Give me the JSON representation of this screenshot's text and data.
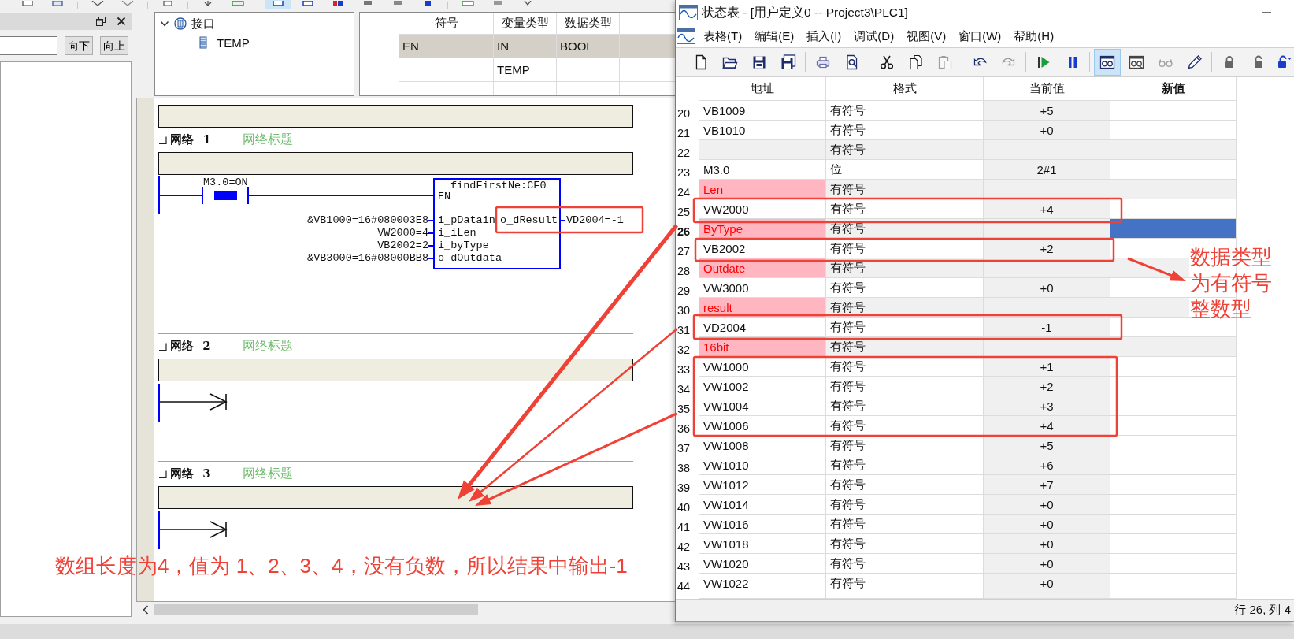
{
  "main_window": {
    "toolbar": [
      [
        {
          "pressed": false
        },
        {
          "pressed": false
        }
      ],
      [
        {
          "pressed": false
        },
        {
          "pressed": false
        }
      ],
      [
        {
          "pressed": false
        }
      ],
      [
        {
          "pressed": false
        },
        {
          "pressed": false
        }
      ],
      [
        {
          "pressed": true
        },
        {
          "pressed": false
        },
        {
          "pressed": false
        },
        {
          "pressed": false
        },
        {
          "pressed": false
        },
        {
          "pressed": false
        }
      ],
      [
        {
          "pressed": false
        },
        {
          "pressed": false
        },
        {
          "pressed": false
        }
      ]
    ],
    "search_buttons": [
      "向下",
      "向上"
    ],
    "interface_tree": [
      {
        "label": "接口",
        "expanded": true,
        "children": [
          {
            "label": "TEMP"
          }
        ]
      }
    ],
    "variable_table": {
      "columns": [
        "符号",
        "变量类型",
        "数据类型"
      ],
      "rows": [
        {
          "symbol": "EN",
          "var_type": "IN",
          "data_type": "BOOL",
          "selected": true
        },
        {
          "var_type": "TEMP",
          "selected": false
        }
      ]
    },
    "networks": [
      {
        "label": "网络 1",
        "title": "网络标题",
        "expanded": true,
        "ladder": {
          "kind": "function_block",
          "contact": {
            "label": "M3.0=ON",
            "energized": true
          },
          "block": {
            "title": "findFirstNe:CF0",
            "enable": "EN",
            "left_pins": [
              {
                "name": "i_pDatain",
                "operand": "&VB1000=16#080003E8"
              },
              {
                "name": "i_iLen",
                "operand": "VW2000=4"
              },
              {
                "name": "i_byType",
                "operand": "VB2002=2"
              },
              {
                "name": "o_dOutdata",
                "operand": "&VB3000=16#08000BB8"
              }
            ],
            "right_pins": [
              {
                "name": "o_dResult",
                "operand": "VD2004=-1"
              }
            ]
          }
        }
      },
      {
        "label": "网络 2",
        "title": "网络标题",
        "expanded": true,
        "ladder": {
          "kind": "empty"
        }
      },
      {
        "label": "网络 3",
        "title": "网络标题",
        "expanded": true,
        "ladder": {
          "kind": "empty"
        }
      }
    ]
  },
  "status_window": {
    "title": "状态表 - [用户定义0 -- Project3\\PLC1]",
    "menu": [
      "表格(T)",
      "编辑(E)",
      "插入(I)",
      "调试(D)",
      "视图(V)",
      "窗口(W)",
      "帮助(H)"
    ],
    "toolbar": [
      [
        {
          "pressed": false,
          "disabled": false
        },
        {
          "pressed": false,
          "disabled": false
        },
        {
          "pressed": false,
          "disabled": false
        },
        {
          "pressed": false,
          "disabled": false
        }
      ],
      [
        {
          "pressed": false,
          "disabled": false
        },
        {
          "pressed": false,
          "disabled": false
        }
      ],
      [
        {
          "pressed": false,
          "disabled": false
        },
        {
          "pressed": false,
          "disabled": false
        },
        {
          "pressed": false,
          "disabled": true
        }
      ],
      [
        {
          "pressed": false,
          "disabled": false
        },
        {
          "pressed": false,
          "disabled": true
        }
      ],
      [
        {
          "pressed": false,
          "disabled": false
        },
        {
          "pressed": false,
          "disabled": false
        }
      ],
      [
        {
          "pressed": true,
          "disabled": false
        },
        {
          "pressed": false,
          "disabled": false
        },
        {
          "pressed": false,
          "disabled": true
        },
        {
          "pressed": false,
          "disabled": false
        }
      ],
      [
        {
          "pressed": false,
          "disabled": false
        },
        {
          "pressed": false,
          "disabled": false
        },
        {
          "pressed": false,
          "disabled": false
        }
      ]
    ],
    "table": {
      "columns": [
        {
          "label": "地址",
          "selected": false
        },
        {
          "label": "格式",
          "selected": false
        },
        {
          "label": "当前值",
          "selected": false
        },
        {
          "label": "新值",
          "selected": true
        }
      ],
      "rows": [
        {
          "number": "20",
          "address": "VB1009",
          "format": "有符号",
          "value": "+5",
          "invalid": false,
          "selected": false
        },
        {
          "number": "21",
          "address": "VB1010",
          "format": "有符号",
          "value": "+0",
          "invalid": false,
          "selected": false
        },
        {
          "number": "22",
          "format": "有符号",
          "invalid": false,
          "selected": false
        },
        {
          "number": "23",
          "address": "M3.0",
          "format": "位",
          "value": "2#1",
          "invalid": false,
          "selected": false
        },
        {
          "number": "24",
          "address": "Len",
          "format": "有符号",
          "invalid": true,
          "selected": false
        },
        {
          "number": "25",
          "address": "VW2000",
          "format": "有符号",
          "value": "+4",
          "invalid": false,
          "selected": false
        },
        {
          "number": "26",
          "address": "ByType",
          "format": "有符号",
          "invalid": true,
          "selected": true
        },
        {
          "number": "27",
          "address": "VB2002",
          "format": "有符号",
          "value": "+2",
          "invalid": false,
          "selected": false
        },
        {
          "number": "28",
          "address": "Outdate",
          "format": "有符号",
          "invalid": true,
          "selected": false
        },
        {
          "number": "29",
          "address": "VW3000",
          "format": "有符号",
          "value": "+0",
          "invalid": false,
          "selected": false
        },
        {
          "number": "30",
          "address": "result",
          "format": "有符号",
          "invalid": true,
          "selected": false
        },
        {
          "number": "31",
          "address": "VD2004",
          "format": "有符号",
          "value": "-1",
          "invalid": false,
          "selected": false
        },
        {
          "number": "32",
          "address": "16bit",
          "format": "有符号",
          "invalid": true,
          "selected": false
        },
        {
          "number": "33",
          "address": "VW1000",
          "format": "有符号",
          "value": "+1",
          "invalid": false,
          "selected": false
        },
        {
          "number": "34",
          "address": "VW1002",
          "format": "有符号",
          "value": "+2",
          "invalid": false,
          "selected": false
        },
        {
          "number": "35",
          "address": "VW1004",
          "format": "有符号",
          "value": "+3",
          "invalid": false,
          "selected": false
        },
        {
          "number": "36",
          "address": "VW1006",
          "format": "有符号",
          "value": "+4",
          "invalid": false,
          "selected": false
        },
        {
          "number": "37",
          "address": "VW1008",
          "format": "有符号",
          "value": "+5",
          "invalid": false,
          "selected": false
        },
        {
          "number": "38",
          "address": "VW1010",
          "format": "有符号",
          "value": "+6",
          "invalid": false,
          "selected": false
        },
        {
          "number": "39",
          "address": "VW1012",
          "format": "有符号",
          "value": "+7",
          "invalid": false,
          "selected": false
        },
        {
          "number": "40",
          "address": "VW1014",
          "format": "有符号",
          "value": "+0",
          "invalid": false,
          "selected": false
        },
        {
          "number": "41",
          "address": "VW1016",
          "format": "有符号",
          "value": "+0",
          "invalid": false,
          "selected": false
        },
        {
          "number": "42",
          "address": "VW1018",
          "format": "有符号",
          "value": "+0",
          "invalid": false,
          "selected": false
        },
        {
          "number": "43",
          "address": "VW1020",
          "format": "有符号",
          "value": "+0",
          "invalid": false,
          "selected": false
        },
        {
          "number": "44",
          "address": "VW1022",
          "format": "有符号",
          "value": "+0",
          "invalid": false,
          "selected": false
        }
      ]
    },
    "status_bar": "行 26, 列 4"
  },
  "annotations": {
    "conclusion": "数组长度为4，值为 1、2、3、4，没有负数，所以结果中输出-1",
    "data_type_note": "数据类型为有符号整数型"
  }
}
